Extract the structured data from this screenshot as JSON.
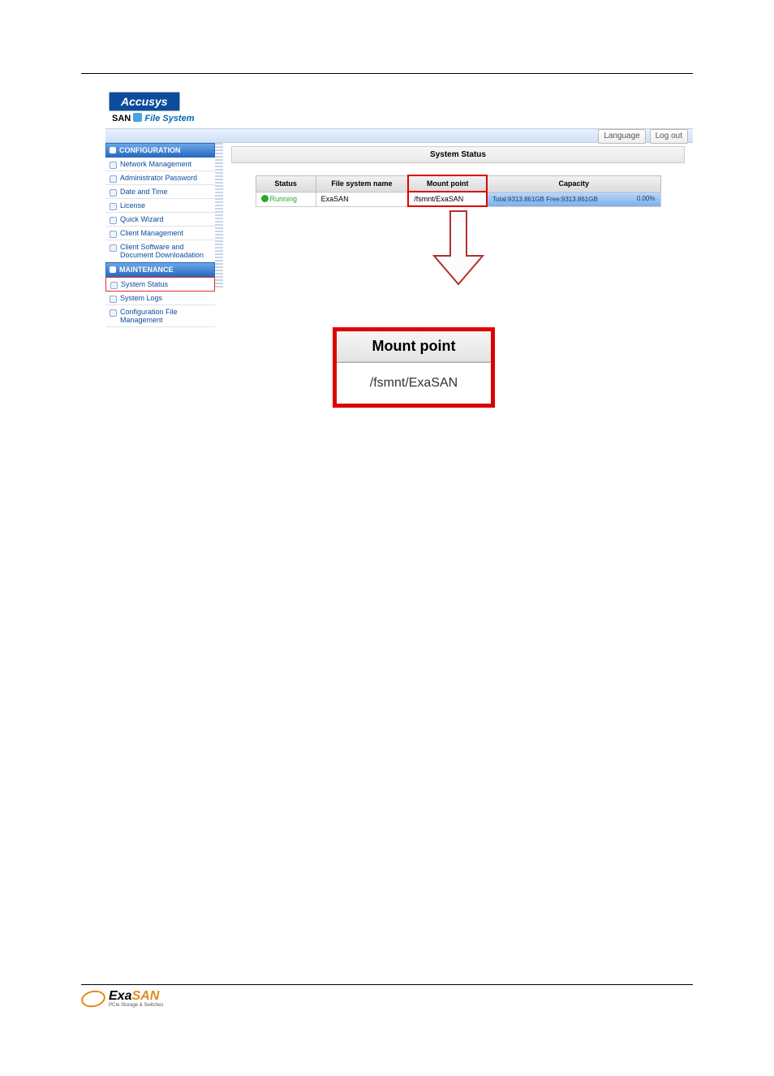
{
  "brand": {
    "logo_text": "Accusys",
    "tagline_san": "SAN",
    "tagline_fs": "File System"
  },
  "header": {
    "language_button": "Language",
    "logout_button": "Log out"
  },
  "sidebar": {
    "configuration_head": "CONFIGURATION",
    "maintenance_head": "MAINTENANCE",
    "config_items": [
      "Network Management",
      "Administrator Password",
      "Date and Time",
      "License",
      "Quick Wizard",
      "Client Management",
      "Client Software and Document Downloadation"
    ],
    "maint_items": [
      "System Status",
      "System Logs",
      "Configuration File Management"
    ]
  },
  "main": {
    "panel_title": "System Status",
    "columns": {
      "status": "Status",
      "fs_name": "File system name",
      "mount_point": "Mount point",
      "capacity": "Capacity"
    },
    "row": {
      "status_label": "Running",
      "fs_name": "ExaSAN",
      "mount_point": "/fsmnt/ExaSAN",
      "capacity_text": "Total:9313.861GB  Free:9313.861GB",
      "capacity_pct": "0.00%"
    }
  },
  "callout": {
    "header": "Mount point",
    "value": "/fsmnt/ExaSAN"
  },
  "footer": {
    "logo_exa": "Exa",
    "logo_san": "SAN",
    "logo_sub": "PCIe Storage & Switches"
  }
}
